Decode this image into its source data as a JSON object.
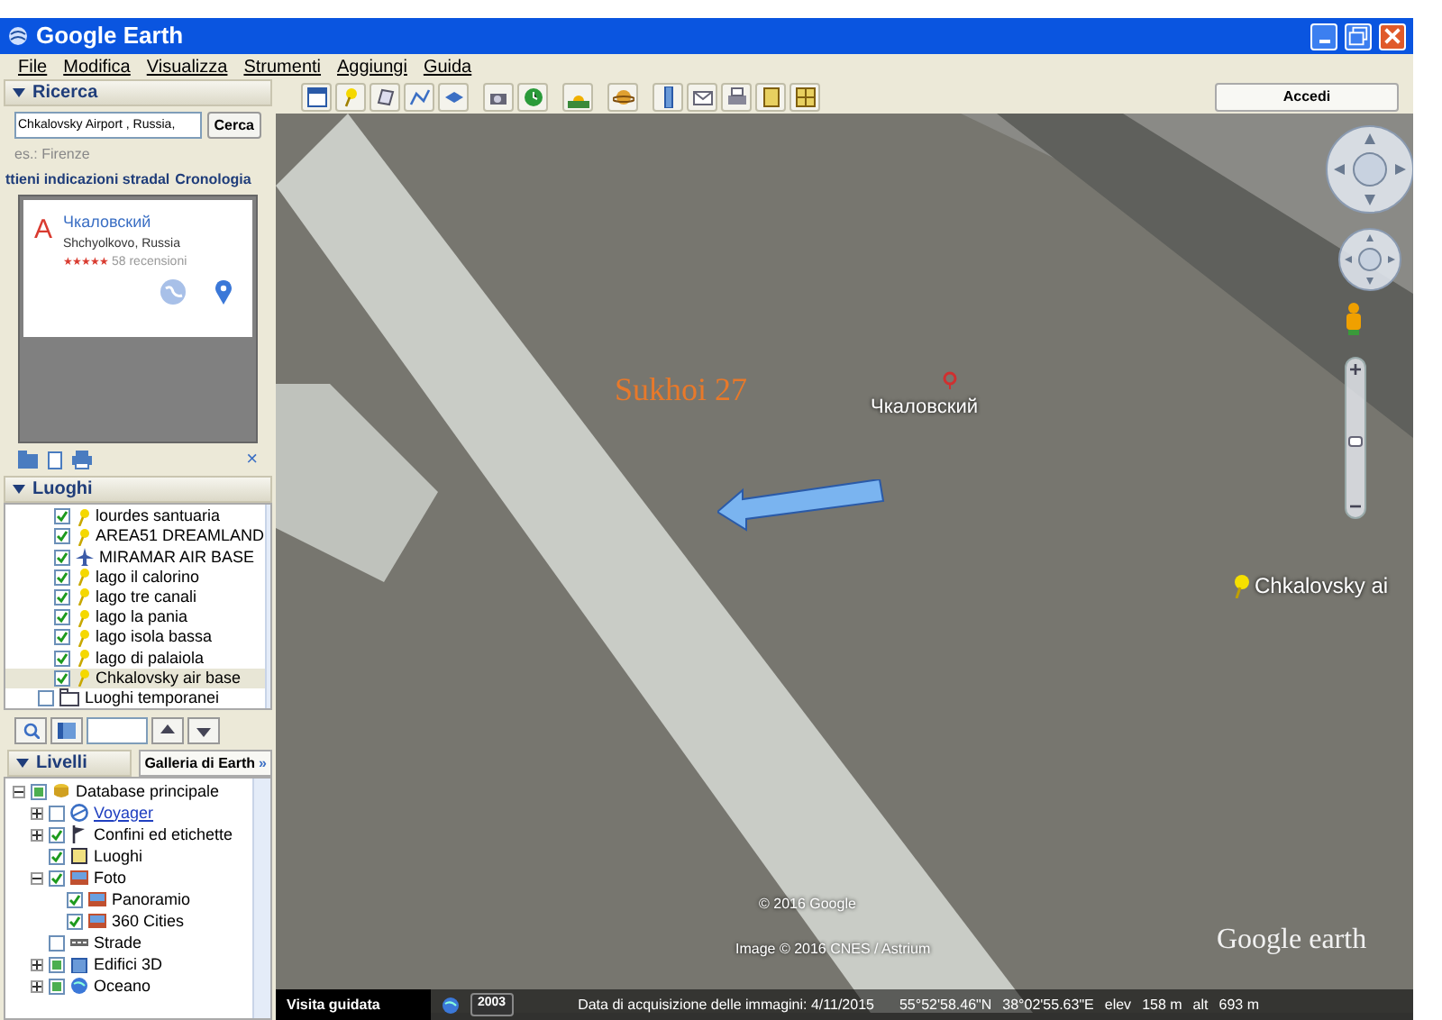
{
  "window": {
    "title": "Google Earth"
  },
  "menu": [
    "File",
    "Modifica",
    "Visualizza",
    "Strumenti",
    "Aggiungi",
    "Guida"
  ],
  "toolbar": {
    "signin": "Accedi"
  },
  "search_panel": {
    "header": "Ricerca",
    "query": "Chkalovsky Airport , Russia,",
    "button": "Cerca",
    "hint": "es.: Firenze",
    "tabs": [
      {
        "label": "ttieni indicazioni stradal",
        "selected": false
      },
      {
        "label": "Cronologia",
        "selected": false
      }
    ],
    "result": {
      "marker": "A",
      "name": "Чкаловский",
      "place": "Shchyolkovo, Russia",
      "stars": 5,
      "reviews": "58 recensioni"
    },
    "close": "×"
  },
  "places_panel": {
    "header": "Luoghi",
    "items": [
      {
        "label": "lourdes santuaria",
        "checked": true,
        "selected": false,
        "kind": "pin"
      },
      {
        "label": "AREA51 DREAMLAND",
        "checked": true,
        "selected": false,
        "kind": "pin"
      },
      {
        "label": "MIRAMAR AIR BASE",
        "checked": true,
        "selected": false,
        "kind": "plane"
      },
      {
        "label": "lago il calorino",
        "checked": true,
        "selected": false,
        "kind": "pin"
      },
      {
        "label": "lago tre canali",
        "checked": true,
        "selected": false,
        "kind": "pin"
      },
      {
        "label": "lago la pania",
        "checked": true,
        "selected": false,
        "kind": "pin"
      },
      {
        "label": "lago isola bassa",
        "checked": true,
        "selected": false,
        "kind": "pin"
      },
      {
        "label": "lago di palaiola",
        "checked": true,
        "selected": false,
        "kind": "pin"
      },
      {
        "label": "Chkalovsky air base",
        "checked": true,
        "selected": true,
        "kind": "pin"
      },
      {
        "label": "Luoghi temporanei",
        "checked": false,
        "selected": false,
        "kind": "folder"
      }
    ]
  },
  "layers_panel": {
    "header": "Livelli",
    "gallery_button": "Galleria di Earth",
    "gallery_arrows": "»",
    "tree": [
      {
        "label": "Database principale",
        "checked": true,
        "mixed": true,
        "expanded": true,
        "kind": "database",
        "children": [
          {
            "label": "Voyager",
            "checked": false,
            "mixed": false,
            "expanded": false,
            "kind": "link"
          },
          {
            "label": "Confini ed etichette",
            "checked": true,
            "mixed": false,
            "expanded": false,
            "kind": "flag"
          },
          {
            "label": "Luoghi",
            "checked": true,
            "mixed": false,
            "kind": "square"
          },
          {
            "label": "Foto",
            "checked": true,
            "mixed": false,
            "expanded": true,
            "kind": "photo",
            "children": [
              {
                "label": "Panoramio",
                "checked": true,
                "mixed": false,
                "kind": "photo"
              },
              {
                "label": "360 Cities",
                "checked": true,
                "mixed": false,
                "kind": "photo"
              }
            ]
          },
          {
            "label": "Strade",
            "checked": false,
            "mixed": false,
            "kind": "road"
          },
          {
            "label": "Edifici 3D",
            "checked": true,
            "mixed": true,
            "expanded": false,
            "kind": "building"
          },
          {
            "label": "Oceano",
            "checked": true,
            "mixed": true,
            "expanded": false,
            "kind": "globe"
          }
        ]
      }
    ]
  },
  "map": {
    "annotation": "Sukhoi 27",
    "place_label": "Чкаловский",
    "pin_label": "Chkalovsky ai",
    "copyright": "© 2016 Google",
    "imagery": "Image © 2016 CNES / Astrium",
    "logo": "Google earth",
    "zoom": {
      "level": 0.5
    }
  },
  "status_bar": {
    "tour_button": "Visita guidata",
    "year": "2003",
    "date": "Data di acquisizione delle immagini: 4/11/2015",
    "lat": "55°52'58.46\"N",
    "lon": "38°02'55.63\"E",
    "elev_label": "elev",
    "elev": "158 m",
    "alt_label": "alt",
    "alt": "693 m"
  }
}
